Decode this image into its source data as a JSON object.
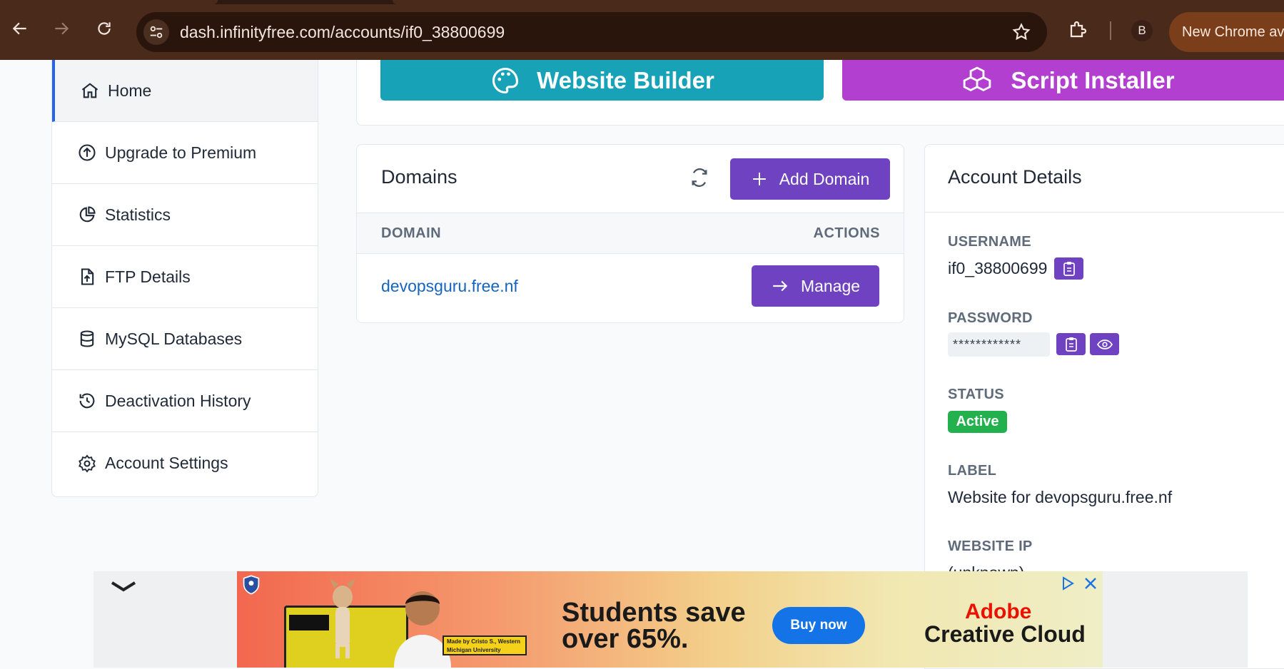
{
  "browser": {
    "url": "dash.infinityfree.com/accounts/if0_38800699",
    "profile_initial": "B",
    "new_chrome_label": "New Chrome av"
  },
  "sidebar": {
    "items": [
      {
        "label": "Home",
        "icon": "home-icon"
      },
      {
        "label": "Upgrade to Premium",
        "icon": "arrow-up-circle-icon"
      },
      {
        "label": "Statistics",
        "icon": "pie-chart-icon"
      },
      {
        "label": "FTP Details",
        "icon": "file-upload-icon"
      },
      {
        "label": "MySQL Databases",
        "icon": "database-icon"
      },
      {
        "label": "Deactivation History",
        "icon": "history-icon"
      },
      {
        "label": "Account Settings",
        "icon": "gear-icon"
      }
    ]
  },
  "builder": {
    "website_builder_label": "Website Builder",
    "script_installer_label": "Script Installer"
  },
  "domains": {
    "title": "Domains",
    "add_label": "Add Domain",
    "columns": [
      "DOMAIN",
      "ACTIONS"
    ],
    "rows": [
      {
        "domain": "devopsguru.free.nf",
        "action": "Manage"
      }
    ]
  },
  "account": {
    "title": "Account Details",
    "username_label": "USERNAME",
    "username": "if0_38800699",
    "password_label": "PASSWORD",
    "password_mask": "************",
    "status_label": "STATUS",
    "status": "Active",
    "label_label": "LABEL",
    "label_value": "Website for devopsguru.free.nf",
    "ip_label": "WEBSITE IP",
    "ip_value": "(unknown)"
  },
  "ad": {
    "headline": "Students save over 65%.",
    "cta": "Buy now",
    "brand_line1": "Adobe",
    "brand_line2": "Creative Cloud",
    "tag_text": "Made by Cristo S., Western Michigan University"
  },
  "colors": {
    "accent": "#6f42c1",
    "builder": "#17a2b8",
    "script": "#b23fcf",
    "active": "#22b14c",
    "link": "#1565c0"
  }
}
